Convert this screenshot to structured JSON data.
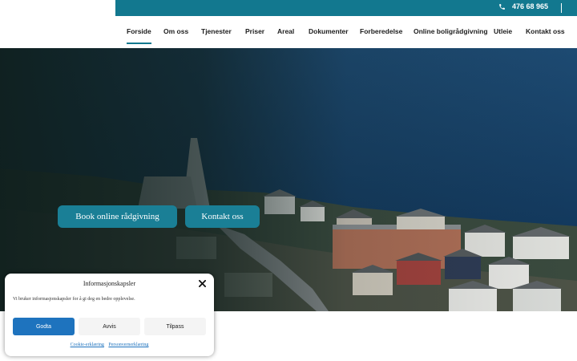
{
  "topbar": {
    "phone": "476 68 965"
  },
  "nav": {
    "items": [
      {
        "label": "Forside",
        "active": true
      },
      {
        "label": "Om oss"
      },
      {
        "label": "Tjenester"
      },
      {
        "label": "Priser"
      },
      {
        "label": "Areal"
      },
      {
        "label": "Dokumenter"
      },
      {
        "label": "Forberedelse"
      },
      {
        "label": "Online boligrådgivning"
      },
      {
        "label": "Utleie"
      },
      {
        "label": "Kontakt oss"
      }
    ]
  },
  "hero": {
    "primary_button": "Book online rådgivning",
    "secondary_button": "Kontakt oss"
  },
  "cookie": {
    "title": "Informasjonskapsler",
    "text": "Vi bruker informasjonskapsler for å gi deg en bedre opplevelse.",
    "accept": "Godta",
    "deny": "Avvis",
    "customize": "Tilpass",
    "link1": "Cookie-erklæring",
    "link2": "Personvernerklæring"
  },
  "colors": {
    "brand": "#12788f",
    "cookie_accent": "#1e73be"
  }
}
